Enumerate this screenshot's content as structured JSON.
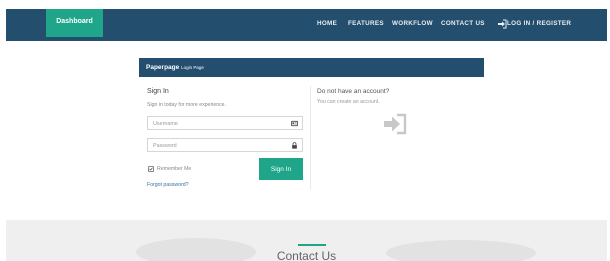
{
  "nav": {
    "brand": "Dashboard",
    "items": [
      "HOME",
      "FEATURES",
      "WORKFLOW",
      "CONTACT US"
    ],
    "login_register": "LOG IN / REGISTER",
    "login_icon": "sign-in-icon"
  },
  "panel": {
    "title": "Paperpage",
    "subtitle": "Login Page"
  },
  "signin": {
    "heading": "Sign In",
    "subtext": "Sign in today for more experience.",
    "username_placeholder": "Username",
    "username_icon": "id-card-icon",
    "password_placeholder": "Password",
    "password_icon": "lock-icon",
    "remember_label": "Remember Me",
    "remember_checked": true,
    "button": "Sign In",
    "forgot": "Forgot password?"
  },
  "register": {
    "heading": "Do not have an account?",
    "subtext": "You can create an account."
  },
  "contact": {
    "title": "Contact Us"
  },
  "colors": {
    "navbar": "#244e6d",
    "accent": "#1fa58a",
    "link": "#3a6fa0"
  }
}
